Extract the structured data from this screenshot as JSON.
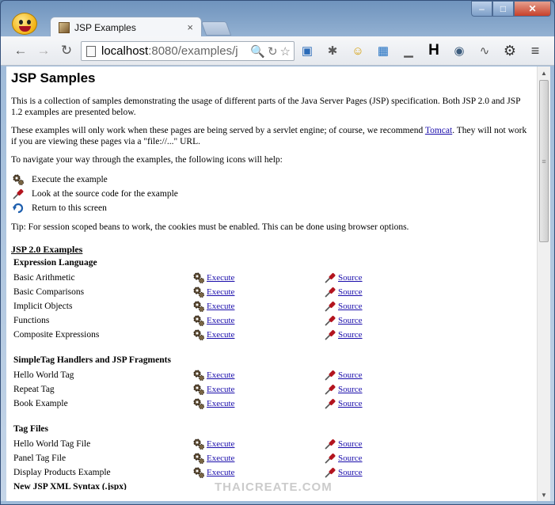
{
  "browser": {
    "tab_title": "JSP Examples",
    "tab_close": "×",
    "url_host": "localhost",
    "url_path": ":8080/examples/j",
    "window_controls": {
      "minimize": "–",
      "maximize": "□",
      "close": "✕"
    }
  },
  "toolbar": {
    "back": "←",
    "forward": "→",
    "reload": "↻",
    "omnibox_icons": {
      "search": "🔍",
      "sync": "↻",
      "star": "☆"
    },
    "extensions": [
      "▣",
      "✱",
      "☺",
      "▦",
      "▁",
      "H",
      "◉",
      "∿",
      "⚙",
      "≡"
    ]
  },
  "page": {
    "title": "JSP Samples",
    "intro": "This is a collection of samples demonstrating the usage of different parts of the Java Server Pages (JSP) specification. Both JSP 2.0 and JSP 1.2 examples are presented below.",
    "servlet_note_before": "These examples will only work when these pages are being served by a servlet engine; of course, we recommend ",
    "servlet_note_link": "Tomcat",
    "servlet_note_after": ". They will not work if you are viewing these pages via a \"file://...\" URL.",
    "navigate_note": "To navigate your way through the examples, the following icons will help:",
    "legend": [
      {
        "icon": "execute-icon",
        "text": "Execute the example"
      },
      {
        "icon": "source-icon",
        "text": "Look at the source code for the example"
      },
      {
        "icon": "return-icon",
        "text": "Return to this screen"
      }
    ],
    "tip": "Tip: For session scoped beans to work, the cookies must be enabled. This can be done using browser options.",
    "section_title": "JSP 2.0 Examples",
    "execute_label": "Execute",
    "source_label": "Source",
    "groups": [
      {
        "title": "Expression Language",
        "items": [
          "Basic Arithmetic",
          "Basic Comparisons",
          "Implicit Objects",
          "Functions",
          "Composite Expressions"
        ]
      },
      {
        "title": "SimpleTag Handlers and JSP Fragments",
        "items": [
          "Hello World Tag",
          "Repeat Tag",
          "Book Example"
        ]
      },
      {
        "title": "Tag Files",
        "items": [
          "Hello World Tag File",
          "Panel Tag File",
          "Display Products Example"
        ]
      }
    ],
    "next_group_cut": "New JSP XML Syntax (.jspx)"
  },
  "watermark": "THAICREATE.COM",
  "colors": {
    "link": "#1a0dab",
    "page_bg": "#ffffff",
    "frame": "#9fbbd9"
  }
}
